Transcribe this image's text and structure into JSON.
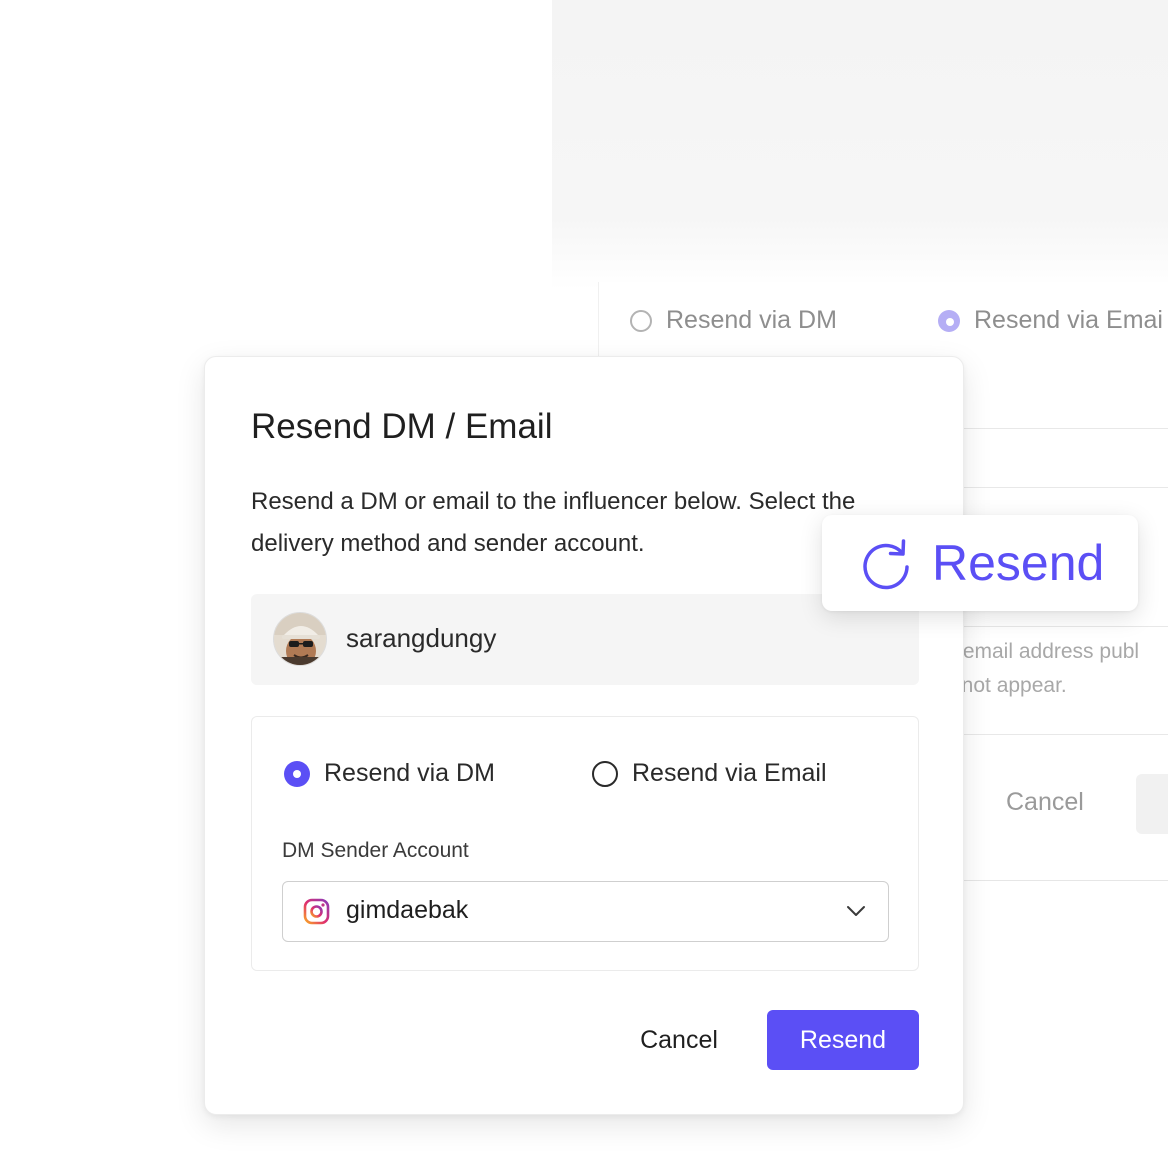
{
  "background": {
    "radio_dm": "Resend via DM",
    "radio_email": "Resend via Emai",
    "hint_line1": "r email address publ",
    "hint_line2": "/ not appear.",
    "cancel_label": "Cancel"
  },
  "chip": {
    "label": "Resend",
    "icon": "refresh-icon"
  },
  "dialog": {
    "title": "Resend DM / Email",
    "description": "Resend a DM or email to the influencer below. Select the delivery method and sender account.",
    "influencer": {
      "username": "sarangdungy",
      "avatar_icon": "avatar"
    },
    "delivery": {
      "options": [
        {
          "label": "Resend via DM",
          "checked": true
        },
        {
          "label": "Resend via Email",
          "checked": false
        }
      ]
    },
    "sender": {
      "label": "DM Sender Account",
      "value": "gimdaebak",
      "icon": "instagram-icon"
    },
    "cancel_label": "Cancel",
    "resend_label": "Resend"
  },
  "colors": {
    "accent": "#5b4ff5",
    "accent_faded": "#b5aef5",
    "text": "#1f1f1f",
    "muted": "#8e8e8e"
  }
}
